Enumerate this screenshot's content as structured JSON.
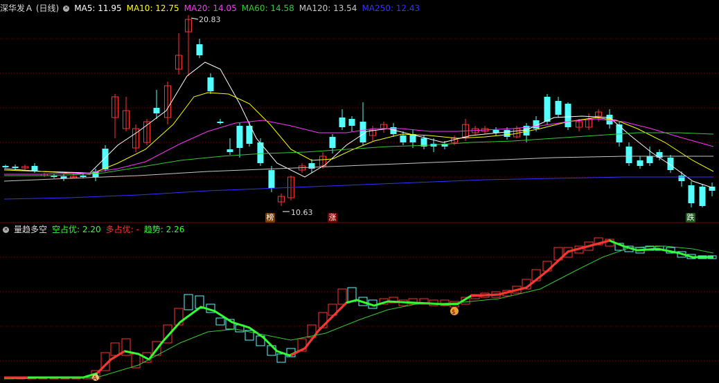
{
  "colors": {
    "up": "#ff3232",
    "down": "#54ffff",
    "ma5": "#ffffff",
    "ma10": "#ffff00",
    "ma20": "#ff33ff",
    "ma60": "#33cc33",
    "ma120": "#c8c8c8",
    "ma250": "#3333ff",
    "grid": "#7a0000"
  },
  "main_header": {
    "stock_label": "深华发Ａ (日线)",
    "ma5_label": "MA5: 11.95",
    "ma10_label": "MA10: 12.75",
    "ma20_label": "MA20: 14.05",
    "ma60_label": "MA60: 14.58",
    "ma120_label": "MA120: 13.54",
    "ma250_label": "MA250: 12.43"
  },
  "main_annotations": {
    "high_label": "20.83",
    "low_label": "10.63",
    "marker_bang": "榜",
    "marker_zhang": "涨",
    "marker_die": "跌"
  },
  "sub_header": {
    "indicator_name": "量趋多空",
    "kong_label": "空占优: 2.20",
    "duo_label": "多占优: -",
    "qushi_label": "趋势: 2.26"
  },
  "sub_annotations": {
    "marker_a": "A",
    "marker_s": "$"
  }
}
